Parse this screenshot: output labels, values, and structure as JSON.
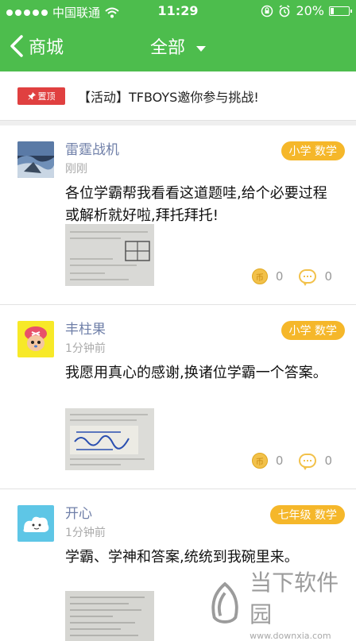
{
  "status_bar": {
    "carrier": "中国联通",
    "time": "11:29",
    "battery": "20%",
    "battery_level": 0.2
  },
  "nav": {
    "back_label": "商城",
    "title": "全部"
  },
  "pinned": {
    "badge": "置顶",
    "text": "【活动】TFBOYS邀你参与挑战!"
  },
  "posts": [
    {
      "user": "雷霆战机",
      "time": "刚刚",
      "tag": "小学 数学",
      "content": "各位学霸帮我看看这道题哇,给个必要过程或解析就好啦,拜托拜托!",
      "coins": "0",
      "comments": "0"
    },
    {
      "user": "丰柱果",
      "time": "1分钟前",
      "tag": "小学 数学",
      "content": "我愿用真心的感谢,换诸位学霸一个答案。",
      "coins": "0",
      "comments": "0"
    },
    {
      "user": "开心",
      "time": "1分钟前",
      "tag": "七年级 数学",
      "content": "学霸、学神和答案,统统到我碗里来。"
    }
  ],
  "watermark": {
    "text": "当下软件园",
    "url": "www.downxia.com"
  },
  "colors": {
    "primary": "#4dbd4d",
    "tag": "#f5b72a",
    "pin": "#e04040",
    "username": "#6f7fa8"
  }
}
